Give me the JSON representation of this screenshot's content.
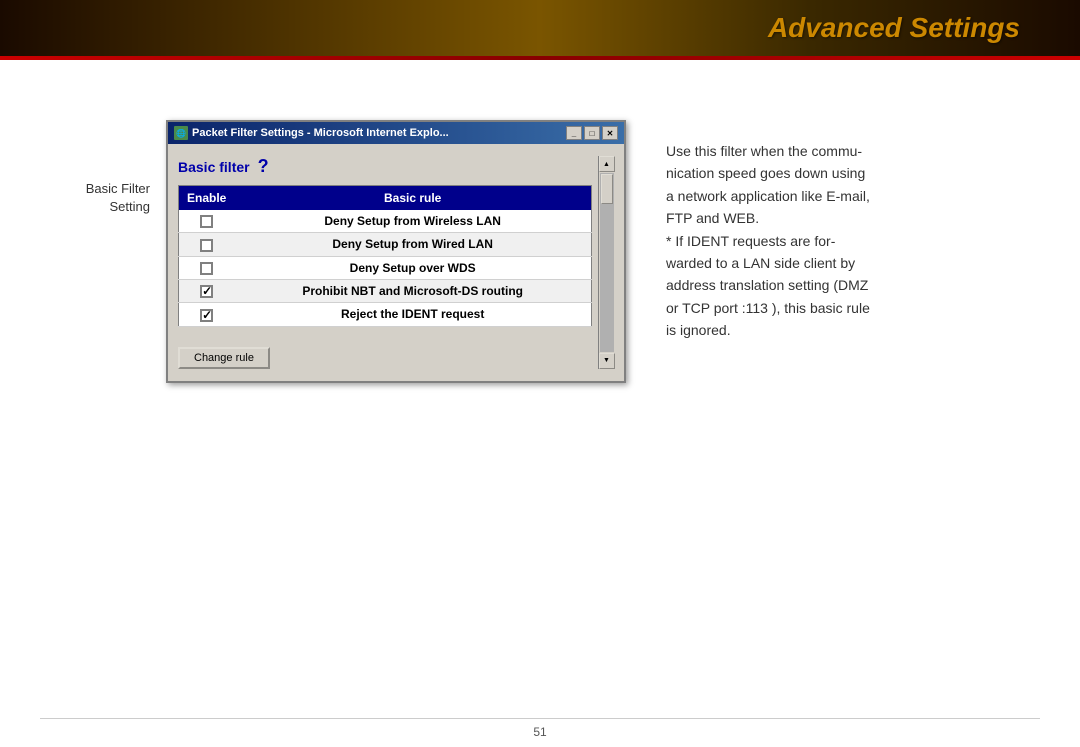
{
  "header": {
    "title": "Advanced Settings"
  },
  "sidebar_label": {
    "line1": "Basic Filter",
    "line2": "Setting"
  },
  "dialog": {
    "title": "Packet Filter Settings - Microsoft Internet Explo...",
    "section_label": "Basic filter",
    "columns": {
      "enable": "Enable",
      "rule": "Basic rule"
    },
    "rows": [
      {
        "checked": false,
        "label": "Deny Setup from Wireless LAN"
      },
      {
        "checked": false,
        "label": "Deny Setup from Wired LAN"
      },
      {
        "checked": false,
        "label": "Deny Setup over WDS"
      },
      {
        "checked": true,
        "label": "Prohibit NBT and Microsoft-DS routing"
      },
      {
        "checked": true,
        "label": "Reject the IDENT request"
      }
    ],
    "change_rule_button": "Change rule"
  },
  "description": {
    "text": "Use this filter when the commu-nication speed goes down using a network application like E-mail, FTP and WEB.\n* If IDENT requests are for-warded to a LAN side client by address translation setting (DMZ or TCP port :113 ), this basic rule is ignored."
  },
  "footer": {
    "page_number": "51"
  }
}
